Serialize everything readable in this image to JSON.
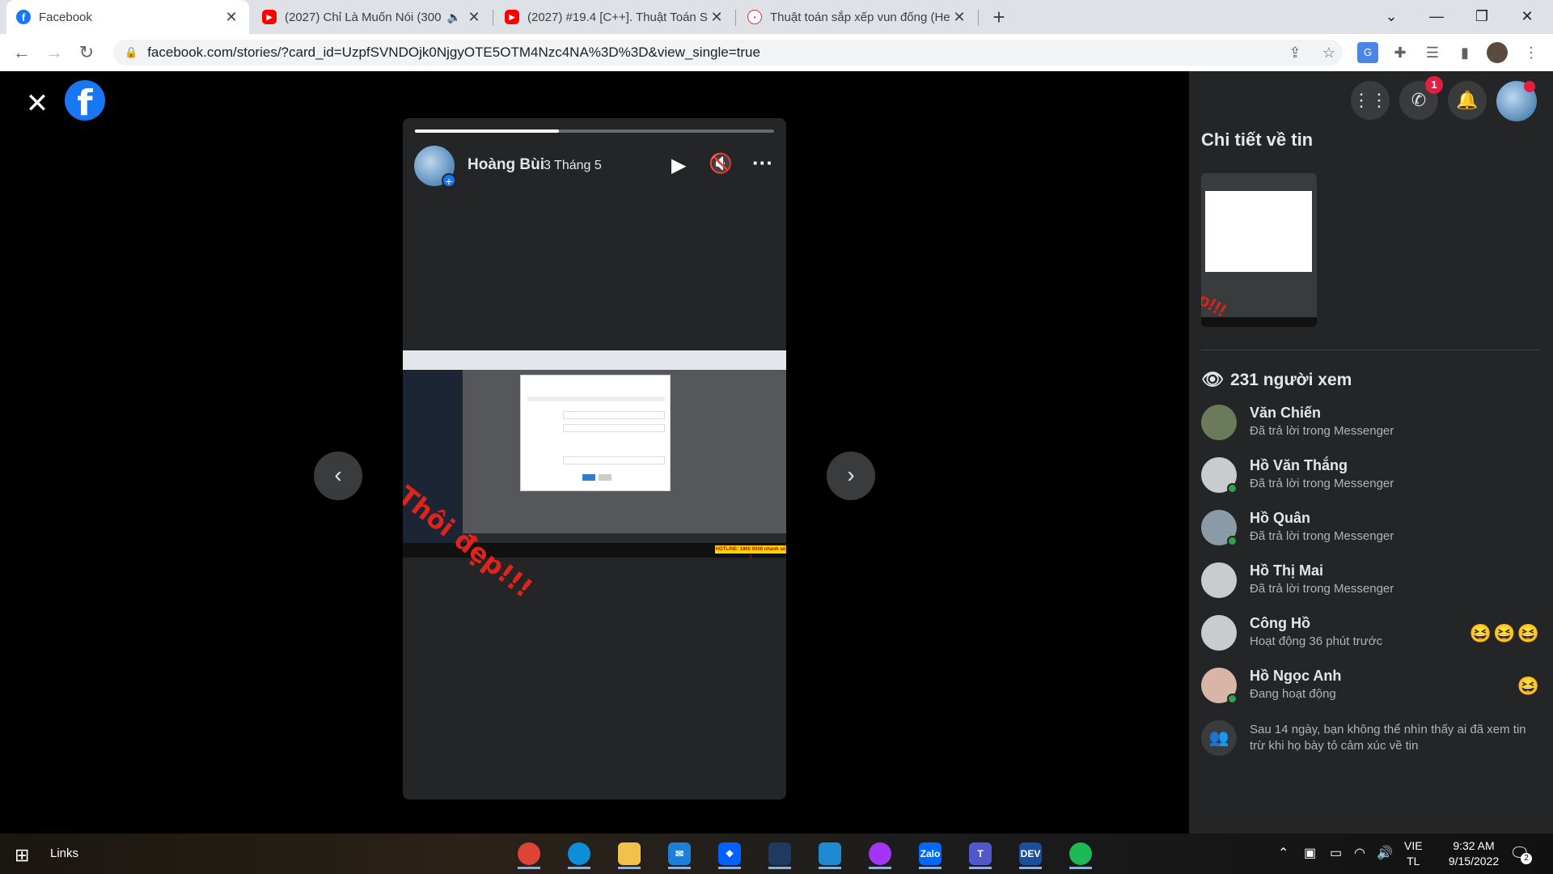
{
  "browser": {
    "tabs": [
      {
        "title": "Facebook",
        "active": true
      },
      {
        "title": "(2027) Chỉ Là Muốn Nói (300",
        "audio": "🔈"
      },
      {
        "title": "(2027) #19.4 [C++]. Thuật Toán S"
      },
      {
        "title": "Thuật toán sắp xếp vun đống (He"
      }
    ],
    "url": "facebook.com/stories/?card_id=UzpfSVNDOjk0NjgyOTE5OTM4Nzc4NA%3D%3D&view_single=true"
  },
  "story": {
    "author": "Hoàng Bùi",
    "time": "3 Tháng 5",
    "progress": 0.4,
    "overlay_text": "Thôi đẹp!!!",
    "hotline": "HOTLINE: 1900 0000 nhánh số 2"
  },
  "panel": {
    "title": "Chi tiết về tin",
    "messenger_badge": "1",
    "views_label": "231 người xem",
    "thumb_text": "p!!!",
    "viewers": [
      {
        "name": "Văn Chiến",
        "status": "Đã trả lời trong Messenger",
        "online": false,
        "reactions": "",
        "avatar": "#6b7a5a"
      },
      {
        "name": "Hồ Văn Thắng",
        "status": "Đã trả lời trong Messenger",
        "online": true,
        "reactions": "",
        "avatar": "#c9cbcf"
      },
      {
        "name": "Hồ Quân",
        "status": "Đã trả lời trong Messenger",
        "online": true,
        "reactions": "",
        "avatar": "#8a9aa6"
      },
      {
        "name": "Hồ Thị Mai",
        "status": "Đã trả lời trong Messenger",
        "online": false,
        "reactions": "",
        "avatar": "#c9cbcf"
      },
      {
        "name": "Công Hồ",
        "status": "Hoạt động 36 phút trước",
        "online": false,
        "reactions": "😆😆😆",
        "avatar": "#c9cbcf"
      },
      {
        "name": "Hồ Ngọc Anh",
        "status": "Đang hoạt động",
        "online": true,
        "reactions": "😆",
        "avatar": "#d7b6a8"
      }
    ],
    "note": "Sau 14 ngày, bạn không thể nhìn thấy ai đã xem tin trừ khi họ bày tỏ cảm xúc về tin"
  },
  "taskbar": {
    "links_label": "Links",
    "language": [
      "VIE",
      "TL"
    ],
    "time": "9:32 AM",
    "date": "9/15/2022",
    "notifications": "2",
    "apps": [
      {
        "name": "chrome",
        "label": "",
        "color": "#db4437"
      },
      {
        "name": "edge",
        "label": "",
        "color": "#0c8ed9"
      },
      {
        "name": "file-explorer",
        "label": "",
        "color": "#f0c14b"
      },
      {
        "name": "mail",
        "label": "✉",
        "color": "#1d7fd8"
      },
      {
        "name": "dropbox",
        "label": "❖",
        "color": "#0061fe"
      },
      {
        "name": "windows-terminal",
        "label": "",
        "color": "#1e3a5f"
      },
      {
        "name": "vscode",
        "label": "",
        "color": "#1f8ad2"
      },
      {
        "name": "messenger",
        "label": "",
        "color": "#a334fa"
      },
      {
        "name": "zalo",
        "label": "Zalo",
        "color": "#0068ff"
      },
      {
        "name": "teams",
        "label": "T",
        "color": "#5059c9"
      },
      {
        "name": "dev-cpp",
        "label": "DEV",
        "color": "#1b4f9c"
      },
      {
        "name": "spotify",
        "label": "",
        "color": "#1db954"
      }
    ]
  }
}
